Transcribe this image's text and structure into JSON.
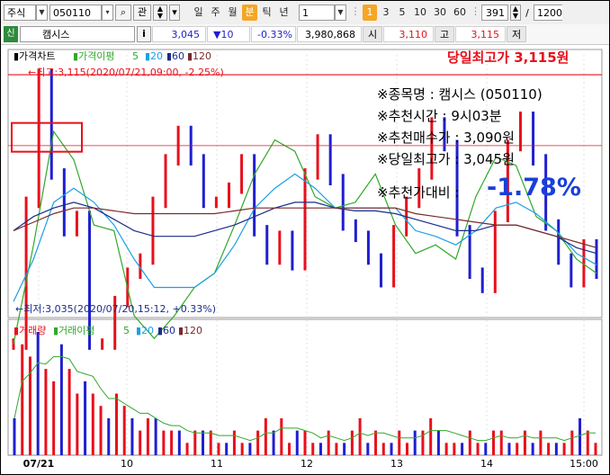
{
  "toolbar": {
    "market_select": "주식",
    "code_input": "050110",
    "search_btn": "⌕",
    "gwan_label": "관",
    "period_tabs": [
      {
        "label": "일",
        "active": false
      },
      {
        "label": "주",
        "active": false
      },
      {
        "label": "월",
        "active": false
      },
      {
        "label": "분",
        "active": true
      },
      {
        "label": "틱",
        "active": false
      },
      {
        "label": "년",
        "active": false
      }
    ],
    "interval_value": "1",
    "minute_buttons": [
      {
        "label": "1",
        "active": true
      },
      {
        "label": "3",
        "active": false
      },
      {
        "label": "5",
        "active": false
      },
      {
        "label": "10",
        "active": false
      },
      {
        "label": "30",
        "active": false
      },
      {
        "label": "60",
        "active": false
      }
    ],
    "count_value": "391",
    "slash": "/",
    "total_value": "1200"
  },
  "quote": {
    "market_badge": "신",
    "stock_name": "캠시스",
    "info_btn": "i",
    "price": "3,045",
    "change": "▼10",
    "change_pct": "-0.33%",
    "volume": "3,980,868",
    "open_label": "시",
    "open_value": "3,110",
    "high_label": "고",
    "high_value": "3,115",
    "low_label": "저"
  },
  "annotations": {
    "day_high": "당일최고가 3,115원",
    "stock_line": "※종목명 : 캠시스 (050110)",
    "time_line": "※추천시간 : 9시03분",
    "buy_line": "※추천매수가 : 3,090원",
    "high_line": "※당일최고가 : 3,045원",
    "ratio_label": "※추천가대비 :",
    "ratio_value": "-1.78%"
  },
  "colors": {
    "up": "#e8101c",
    "down": "#1f1fd0",
    "ma5": "#31a82b",
    "ma20": "#1aa0e6",
    "ma60": "#1a2c8c",
    "ma120": "#7a2a2a",
    "annot_red": "#e8101c",
    "annot_blue": "#1a3fd8"
  },
  "chart_data": [
    {
      "type": "line",
      "title": "가격차트",
      "legend": [
        "가격이평",
        "5",
        "20",
        "60",
        "120"
      ],
      "series": [
        {
          "name": "5",
          "values": [
            3020,
            3055,
            3095,
            3085,
            3062,
            3060,
            3030,
            3022,
            3030,
            3040,
            3045,
            3062,
            3080,
            3092,
            3088,
            3072,
            3068,
            3070,
            3080,
            3062,
            3052,
            3055,
            3050,
            3072,
            3086,
            3083,
            3065,
            3060,
            3050,
            3045
          ]
        },
        {
          "name": "20",
          "values": [
            3035,
            3050,
            3070,
            3075,
            3070,
            3062,
            3050,
            3040,
            3040,
            3040,
            3045,
            3055,
            3068,
            3075,
            3080,
            3075,
            3068,
            3068,
            3068,
            3068,
            3060,
            3058,
            3055,
            3060,
            3068,
            3070,
            3066,
            3060,
            3052,
            3048
          ]
        },
        {
          "name": "60",
          "values": [
            3060,
            3065,
            3068,
            3070,
            3068,
            3064,
            3060,
            3058,
            3058,
            3058,
            3060,
            3062,
            3065,
            3068,
            3070,
            3070,
            3068,
            3067,
            3067,
            3066,
            3064,
            3062,
            3060,
            3060,
            3062,
            3062,
            3060,
            3058,
            3054,
            3052
          ]
        },
        {
          "name": "120",
          "values": [
            3060,
            3063,
            3066,
            3068,
            3068,
            3067,
            3066,
            3066,
            3066,
            3066,
            3066,
            3067,
            3068,
            3068,
            3068,
            3068,
            3068,
            3068,
            3068,
            3068,
            3066,
            3065,
            3064,
            3063,
            3062,
            3062,
            3060,
            3058,
            3056,
            3054
          ]
        }
      ],
      "price_bars": [
        3020,
        3070,
        3115,
        3080,
        3060,
        3065,
        3020,
        3020,
        3035,
        3045,
        3050,
        3070,
        3085,
        3095,
        3085,
        3070,
        3070,
        3075,
        3085,
        3060,
        3050,
        3058,
        3048,
        3080,
        3092,
        3078,
        3062,
        3058,
        3050,
        3042,
        3060,
        3070,
        3080,
        3098,
        3090,
        3060,
        3045,
        3040,
        3065,
        3090,
        3100,
        3085,
        3062,
        3050,
        3042,
        3055,
        3045
      ],
      "ylim": [
        3030,
        3122
      ],
      "max_label": "←최고:3,115(2020/07/21,09:00, -2.25%)",
      "min_label": "←최저:3,035(2020/07/20,15:12, +0.33%)"
    },
    {
      "type": "bar",
      "title": "거래량",
      "legend": [
        "거래이평",
        "5",
        "20",
        "60",
        "120"
      ],
      "values": [
        3,
        9,
        8,
        10,
        7,
        6,
        9,
        7,
        5,
        6,
        5,
        4,
        3,
        5,
        4,
        3,
        2,
        3,
        3,
        2,
        2,
        2,
        1,
        2,
        2,
        2,
        1,
        1,
        2,
        1,
        1,
        2,
        3,
        2,
        3,
        1,
        2,
        2,
        1,
        1,
        2,
        1,
        1,
        2,
        3,
        1,
        2,
        1,
        1,
        2,
        1,
        2,
        2,
        3,
        2,
        1,
        1,
        1,
        2,
        1,
        1,
        2,
        2,
        1,
        1,
        2,
        1,
        2,
        1,
        1,
        1,
        2,
        3,
        2,
        1
      ],
      "ylim": [
        0,
        10
      ]
    }
  ],
  "x_ticks": [
    "07/21",
    "10",
    "11",
    "12",
    "13",
    "14",
    "15:00"
  ]
}
